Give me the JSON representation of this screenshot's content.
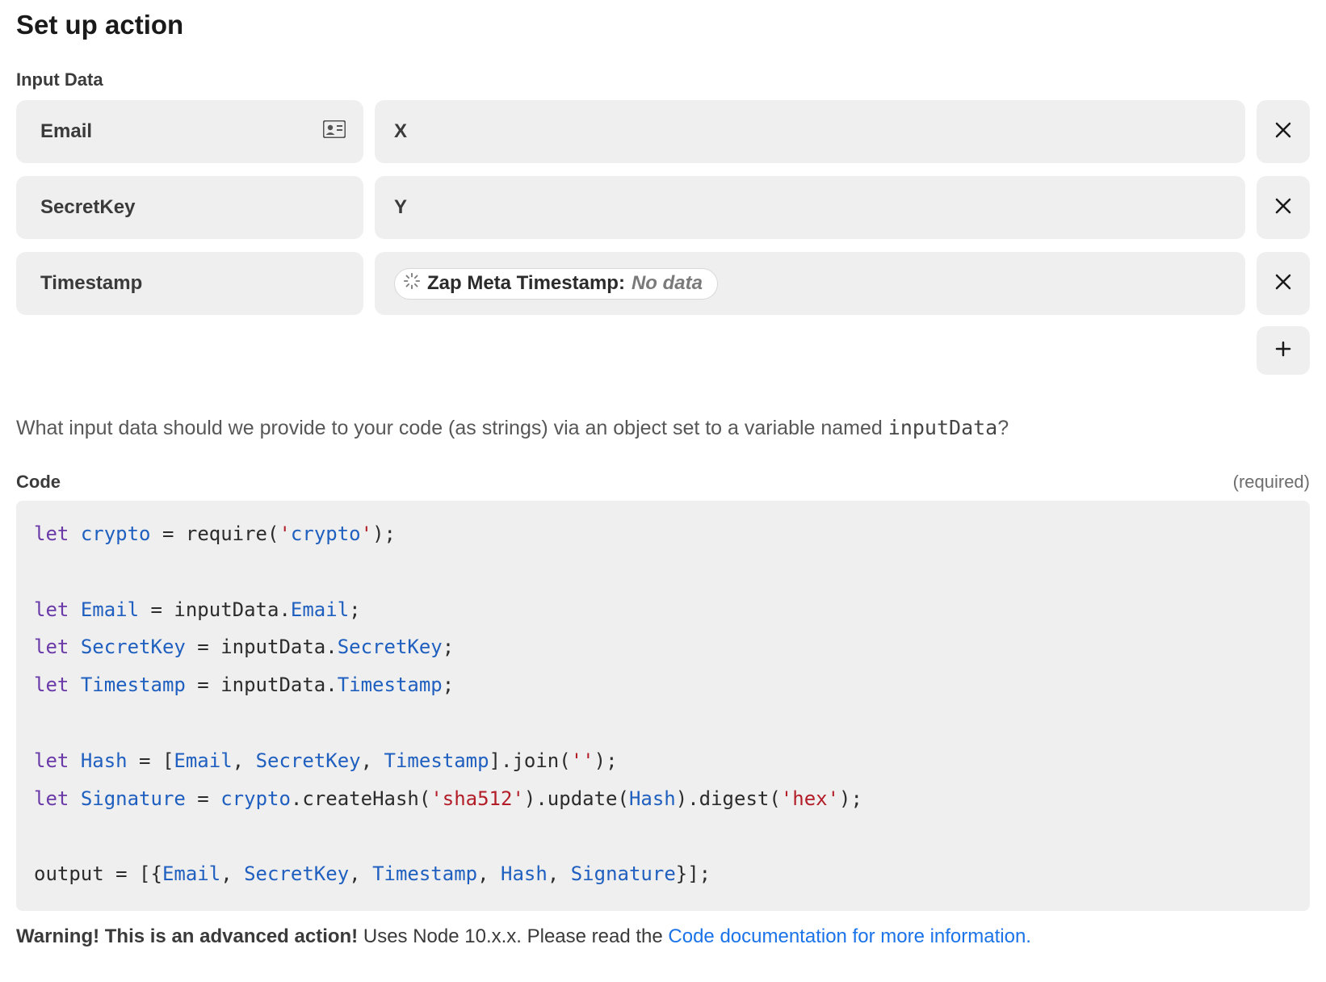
{
  "title": "Set up action",
  "inputData": {
    "label": "Input Data",
    "rows": [
      {
        "key": "Email",
        "value": "X",
        "hasCardIcon": true
      },
      {
        "key": "SecretKey",
        "value": "Y"
      },
      {
        "key": "Timestamp",
        "pill": {
          "label": "Zap Meta Timestamp:",
          "value": "No data"
        }
      }
    ]
  },
  "hint": {
    "prefix": "What input data should we provide to your code (as strings) via an object set to a variable named ",
    "code": "inputData",
    "suffix": "?"
  },
  "codeSection": {
    "label": "Code",
    "required": "(required)",
    "code": "let crypto = require('crypto');\n\nlet Email = inputData.Email;\nlet SecretKey = inputData.SecretKey;\nlet Timestamp = inputData.Timestamp;\n\nlet Hash = [Email, SecretKey, Timestamp].join('');\nlet Signature = crypto.createHash('sha512').update(Hash).digest('hex');\n\noutput = [{Email, SecretKey, Timestamp, Hash, Signature}];"
  },
  "warning": {
    "bold": "Warning! This is an advanced action!",
    "text": " Uses Node 10.x.x. Please read the ",
    "link": "Code documentation for more information."
  }
}
